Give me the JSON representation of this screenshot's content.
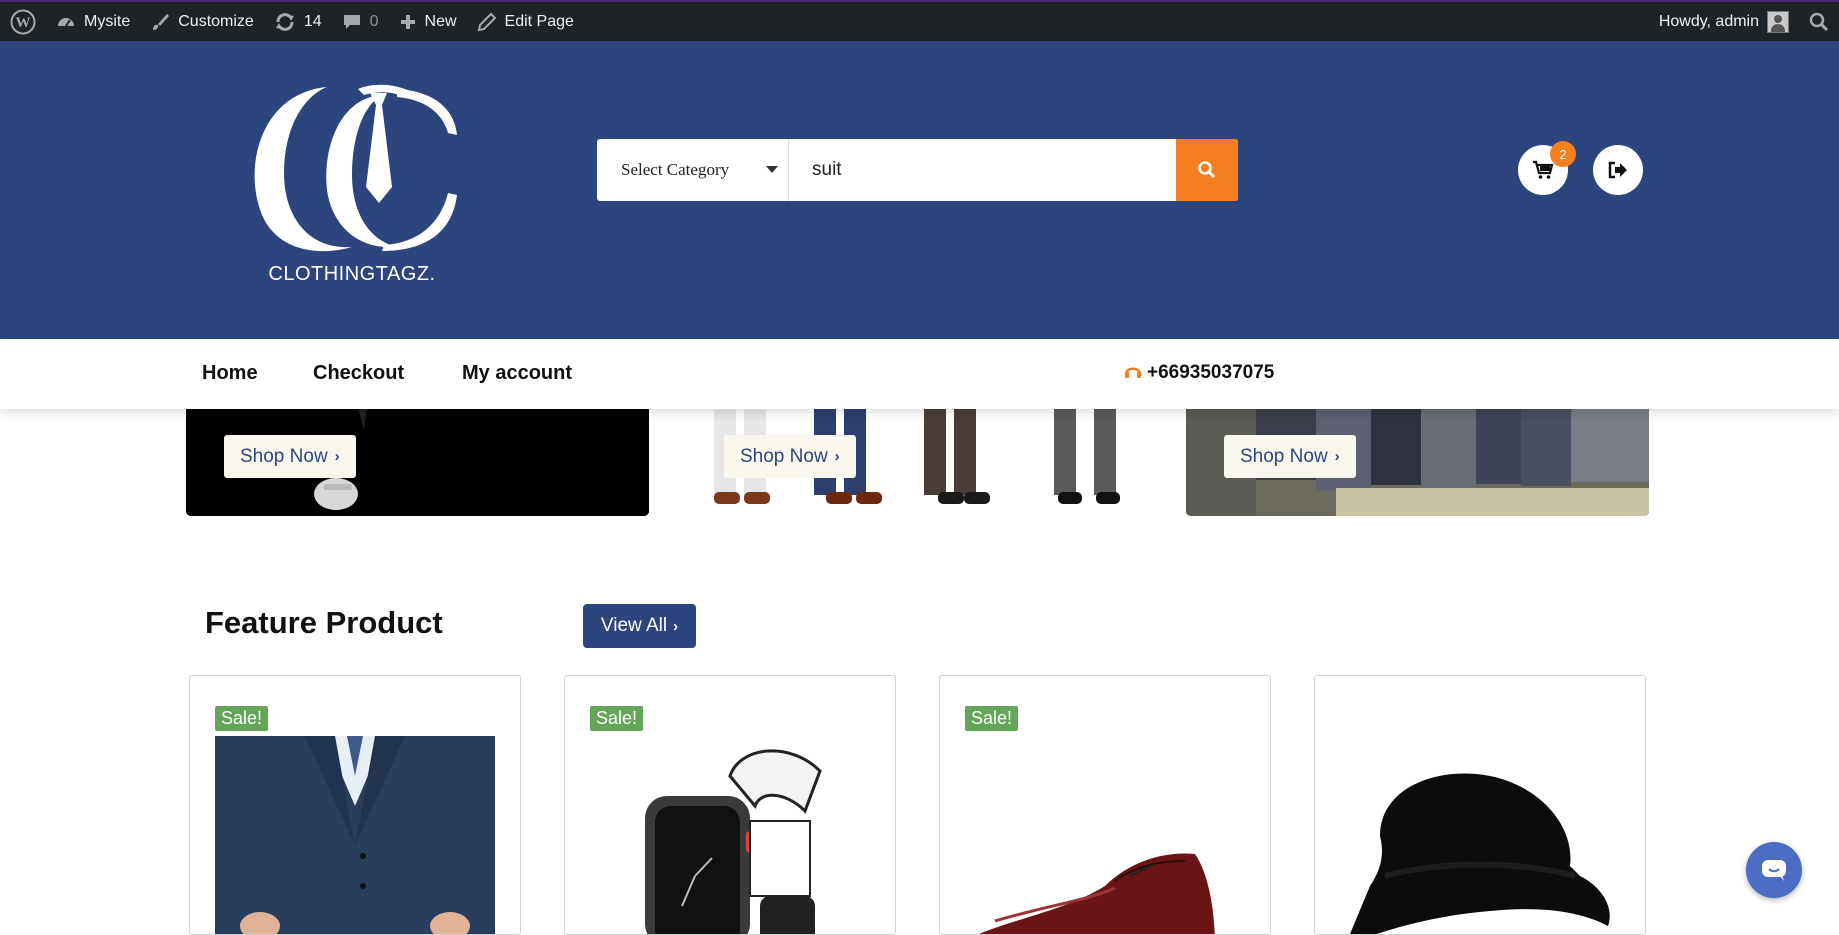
{
  "adminbar": {
    "site_name": "Mysite",
    "customize": "Customize",
    "updates_count": "14",
    "comments_count": "0",
    "new_label": "New",
    "edit_page": "Edit Page",
    "howdy": "Howdy, admin"
  },
  "header": {
    "logo_text": "CLOTHINGTAGZ.",
    "search": {
      "category_label": "Select Category",
      "query_value": "suit"
    },
    "cart_count": "2"
  },
  "nav": {
    "items": [
      {
        "label": "Home"
      },
      {
        "label": "Checkout"
      },
      {
        "label": "My account"
      }
    ],
    "phone": "+66935037075"
  },
  "banners": [
    {
      "cta": "Shop Now"
    },
    {
      "cta": "Shop Now"
    },
    {
      "cta": "Shop Now"
    }
  ],
  "feature": {
    "title": "Feature Product",
    "view_all": "View All",
    "products": [
      {
        "badge": "Sale!",
        "image": "navy-suit"
      },
      {
        "badge": "Sale!",
        "image": "smart-watch"
      },
      {
        "badge": "Sale!",
        "image": "red-leather-shoe"
      },
      {
        "badge": "",
        "image": "black-fedora-hat"
      }
    ]
  },
  "colors": {
    "brand_blue": "#2c457c",
    "accent_orange": "#f37f22",
    "sale_green": "#64a55a",
    "adminbar_bg": "#1d2327"
  }
}
